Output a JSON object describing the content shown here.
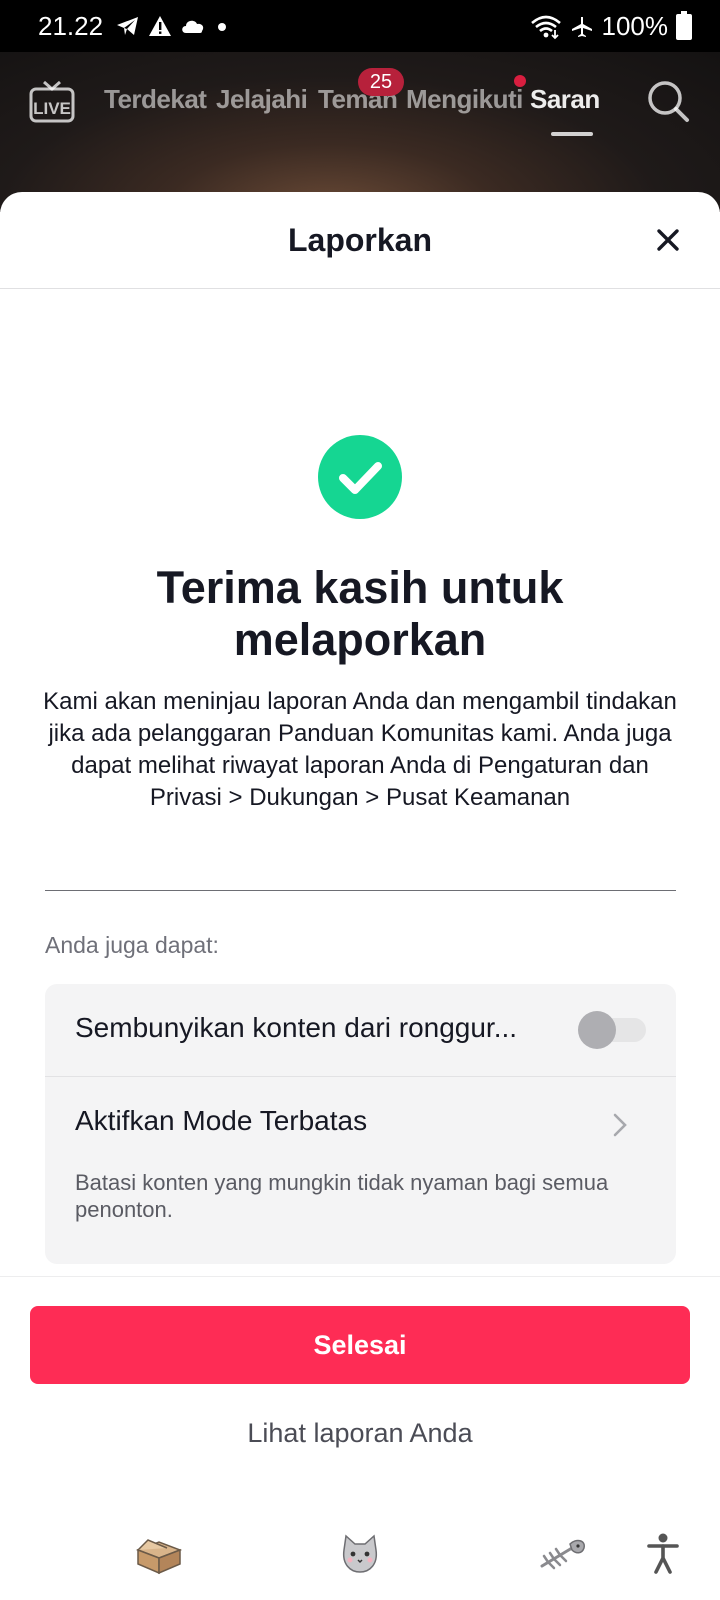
{
  "status_bar": {
    "time": "21.22",
    "battery": "100%",
    "icons": [
      "telegram-icon",
      "alert-icon",
      "cloud-icon",
      "dot-icon",
      "wifi-icon",
      "airplane-icon",
      "battery-icon"
    ]
  },
  "top_nav": {
    "live_label": "LIVE",
    "tabs": [
      {
        "label": "Terdekat"
      },
      {
        "label": "Jelajahi"
      },
      {
        "label": "Teman"
      },
      {
        "label": "Mengikuti"
      },
      {
        "label": "Saran"
      }
    ],
    "friends_badge": "25",
    "active_tab": "Saran"
  },
  "sheet": {
    "title": "Laporkan",
    "headline": "Terima kasih untuk melaporkan",
    "body": "Kami akan meninjau laporan Anda dan mengambil tindakan jika ada pelanggaran Panduan Komunitas kami. Anda juga dapat melihat riwayat laporan Anda di Pengaturan dan Privasi > Dukungan > Pusat Keamanan",
    "also_label": "Anda juga dapat:",
    "options": {
      "hide_label": "Sembunyikan konten dari ronggur...",
      "hide_toggle_on": false,
      "restricted_label": "Aktifkan Mode Terbatas",
      "restricted_desc": "Batasi konten yang mungkin tidak nyaman bagi semua penonton."
    },
    "done_button": "Selesai",
    "view_reports_link": "Lihat laporan Anda"
  },
  "colors": {
    "accent": "#fe2c55",
    "success": "#15d692",
    "badge": "#b7213b"
  },
  "bottom_icons": [
    "box-icon",
    "cat-icon",
    "fishbone-icon",
    "accessibility-icon"
  ]
}
